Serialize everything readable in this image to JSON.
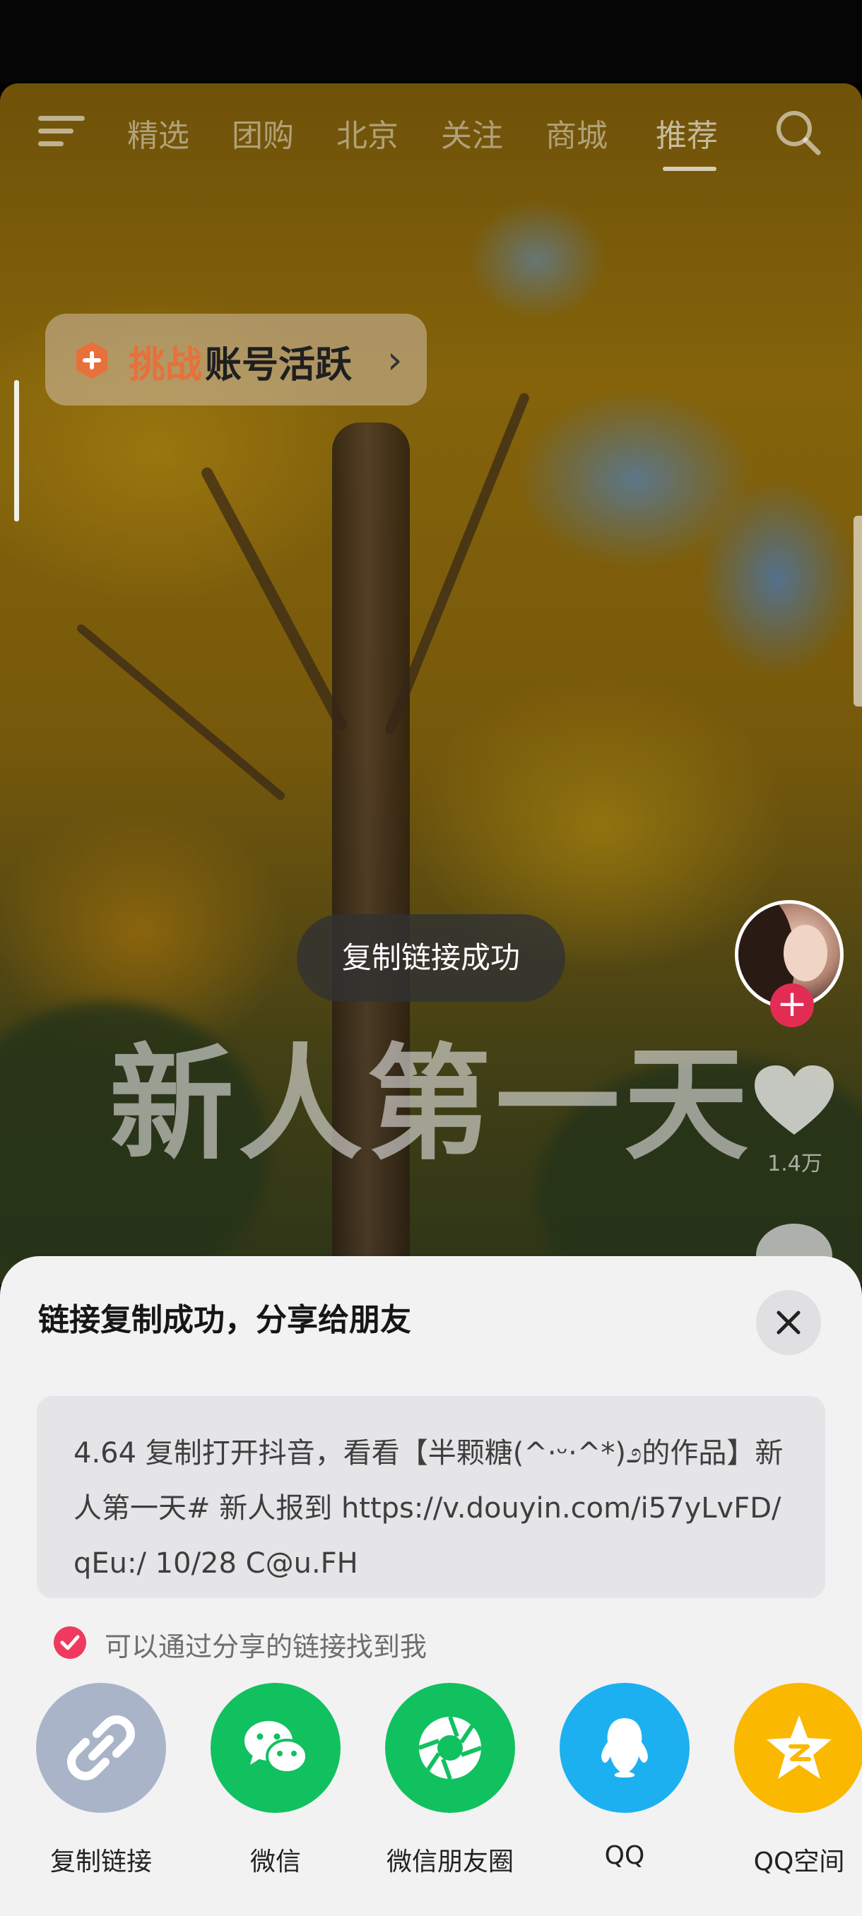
{
  "top_tabs": [
    "精选",
    "团购",
    "北京",
    "关注",
    "商城",
    "推荐"
  ],
  "active_tab": "推荐",
  "challenge": {
    "prefix": "挑战",
    "label": "账号活跃"
  },
  "toast": "复制链接成功",
  "video_title": "新人第一天",
  "like_count": "1.4万",
  "sheet": {
    "title": "链接复制成功，分享给朋友",
    "link_text": "4.64 复制打开抖音，看看【半颗糖(^·ᵕ·^*)೨的作品】新人第一天# 新人报到 https://v.douyin.com/i57yLvFD/ qEu:/ 10/28 C@u.FH",
    "checkbox_label": "可以通过分享的链接找到我",
    "share_targets": [
      {
        "label": "复制链接",
        "icon": "link-icon",
        "color": "#a9b4c8"
      },
      {
        "label": "微信",
        "icon": "wechat-icon",
        "color": "#11c15f"
      },
      {
        "label": "微信朋友圈",
        "icon": "moments-icon",
        "color": "#11c15f"
      },
      {
        "label": "QQ",
        "icon": "qq-icon",
        "color": "#1cb0f0"
      },
      {
        "label": "QQ空间",
        "icon": "qzone-icon",
        "color": "#fbb800"
      }
    ]
  }
}
